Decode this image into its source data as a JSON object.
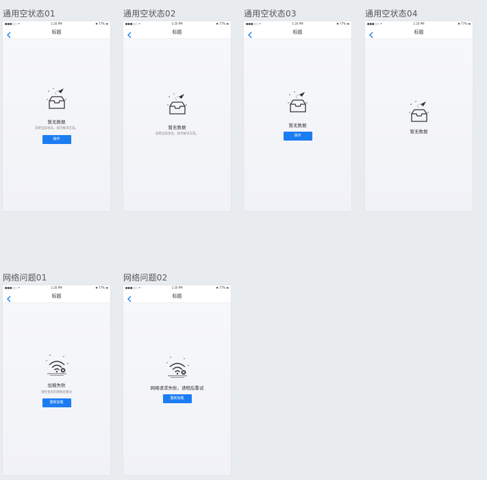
{
  "status_bar": {
    "signal": "●●●○○ ᯤ",
    "time": "1:20 PM",
    "battery": "✱ 77% ▬"
  },
  "nav_title": "标题",
  "colors": {
    "accent": "#1c7cf2",
    "background": "#e9ecef"
  },
  "empty_states": [
    {
      "label": "通用空状态01",
      "message": "暂无数据",
      "description": "说明当前状态、提示解决方案。",
      "button": "操作"
    },
    {
      "label": "通用空状态02",
      "message": "暂无数据",
      "description": "说明当前状态、提示解决方案。"
    },
    {
      "label": "通用空状态03",
      "message": "暂无数据",
      "button": "操作"
    },
    {
      "label": "通用空状态04",
      "message": "暂无数据"
    }
  ],
  "network_errors": [
    {
      "label": "网络问题01",
      "message": "加载失败",
      "description": "请检查您的网络后重试",
      "button": "重新加载"
    },
    {
      "label": "网络问题02",
      "message": "网络请求失败，请稍后重试",
      "button": "重新加载"
    }
  ]
}
